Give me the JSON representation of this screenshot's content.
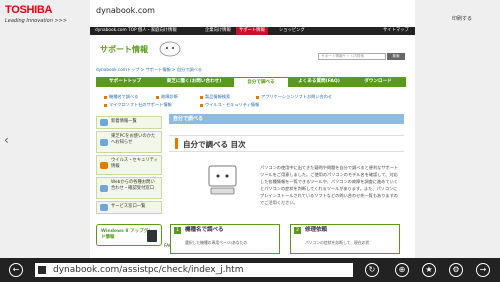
{
  "header": {
    "logo": "TOSHIBA",
    "logo_tagline": "Leading Innovation >>>",
    "site_title": "dynabook.com",
    "print_link": "印刷する"
  },
  "topbar": {
    "items": [
      "dynabook.com TOP 個人・家庭向け情報",
      "企業向け情報",
      "サポート情報",
      "ショッピング",
      "サイトマップ"
    ],
    "active_index": 2
  },
  "support": {
    "title": "サポート情報",
    "search_placeholder": "サポート情報サイト内検索",
    "search_button": "検索"
  },
  "breadcrumb": "dynabook.comトップ > サポート情報 > 自分で調べる",
  "mainnav": {
    "items": [
      "サポートトップ",
      "東芝に聞く(お問い合わせ)",
      "自分で調べる",
      "よくある質問(FAQ)",
      "ダウンロード"
    ],
    "active_index": 2
  },
  "subnav": {
    "items": [
      "機種名で調べる",
      "故障診断",
      "製品情報検索",
      "アプリケーションソフトお問い合わせ",
      "マイクロソフト社のサポート情報",
      "ウイルス・セキュリティ情報"
    ]
  },
  "leftmenu": {
    "items": [
      "新着情報一覧",
      "東芝PCをお使いのかたへお知らせ",
      "ウイルス・セキュリティ情報",
      "Webからの各種お問い合わせ・確認受付窓口",
      "サービス窓口一覧"
    ]
  },
  "banner": {
    "text": "Windows 8 アップグレード情報"
  },
  "faq_label": "FAQ",
  "content": {
    "section_head": "自分で調べる",
    "page_title": "自分で調べる 目次",
    "description": "パソコンの使用中に出てきた疑問や問題を自分で調べると便利なサポートツールをご用意しました。ご使用のパソコンのモデル名を確認して、対応した各種情報を一覧できるツールや、パソコンの故障を調査に進めていくとパソコンの症状を判断してくれるツールがあります。また、パソコンにプレインストールされているソフトなどの問い合わせ先一覧もありますのでご活用ください。",
    "cards": [
      {
        "num": "1",
        "title": "機種名で調べる",
        "text": "選択した機種の専用ページ(あなたの"
      },
      {
        "num": "2",
        "title": "修理依頼",
        "text": "パソコンの症状を診断して、現在の状"
      }
    ]
  },
  "browser": {
    "url": "dynabook.com/assistpc/check/index_j.htm"
  }
}
